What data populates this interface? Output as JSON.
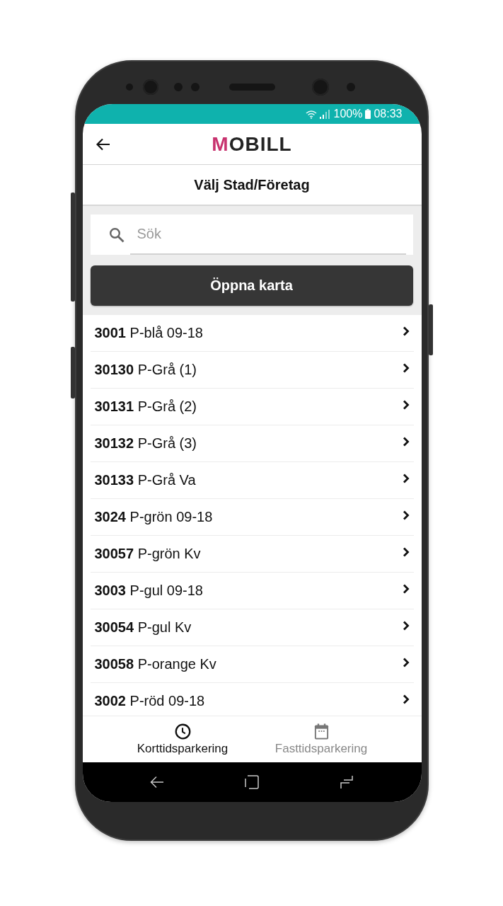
{
  "status_bar": {
    "battery": "100%",
    "time": "08:33"
  },
  "app_bar": {
    "logo": "MOBILL"
  },
  "page_title": "Välj Stad/Företag",
  "search": {
    "placeholder": "Sök"
  },
  "map_button": "Öppna karta",
  "zones": [
    {
      "code": "3001",
      "name": "P-blå 09-18"
    },
    {
      "code": "30130",
      "name": "P-Grå (1)"
    },
    {
      "code": "30131",
      "name": "P-Grå (2)"
    },
    {
      "code": "30132",
      "name": "P-Grå (3)"
    },
    {
      "code": "30133",
      "name": "P-Grå Va"
    },
    {
      "code": "3024",
      "name": "P-grön 09-18"
    },
    {
      "code": "30057",
      "name": "P-grön Kv"
    },
    {
      "code": "3003",
      "name": "P-gul 09-18"
    },
    {
      "code": "30054",
      "name": "P-gul Kv"
    },
    {
      "code": "30058",
      "name": "P-orange Kv"
    },
    {
      "code": "3002",
      "name": "P-röd 09-18"
    }
  ],
  "bottom_nav": [
    {
      "kind": "clock",
      "label": "Korttidsparkering",
      "selected": true
    },
    {
      "kind": "calendar",
      "label": "Fasttidsparkering",
      "selected": false
    }
  ]
}
